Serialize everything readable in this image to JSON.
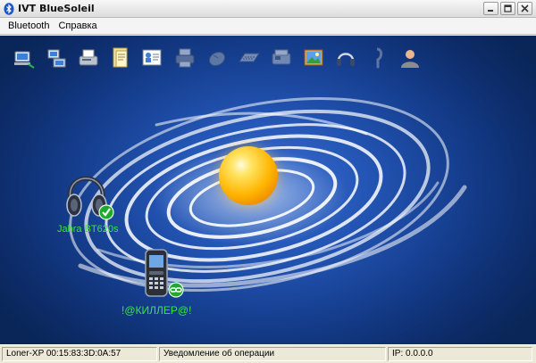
{
  "window": {
    "title": "IVT BlueSoleil"
  },
  "menu": {
    "items": [
      "Bluetooth",
      "Справка"
    ]
  },
  "toolbar": {
    "icons": [
      "network-access-icon",
      "dial-up-networking-icon",
      "fax-icon",
      "file-transfer-icon",
      "business-card-icon",
      "printer-icon",
      "mouse-icon",
      "keyboard-icon",
      "pim-sync-icon",
      "picture-transfer-icon",
      "headset-icon",
      "personal-area-network-icon",
      "contact-icon"
    ]
  },
  "devices": [
    {
      "name": "Jabra BT620s",
      "icon": "headphones-icon",
      "status": "connected"
    },
    {
      "name": "!@КИЛЛЕР@!",
      "icon": "mobile-phone-icon",
      "status": "paired"
    }
  ],
  "status": {
    "local_device": "Loner-XP 00:15:83:3D:0A:57",
    "notification": "Уведомление об операции",
    "ip": "IP: 0.0.0.0"
  },
  "colors": {
    "canvas_bg": "#153e8e",
    "device_label": "#39e639",
    "sphere": "#ffb400"
  }
}
